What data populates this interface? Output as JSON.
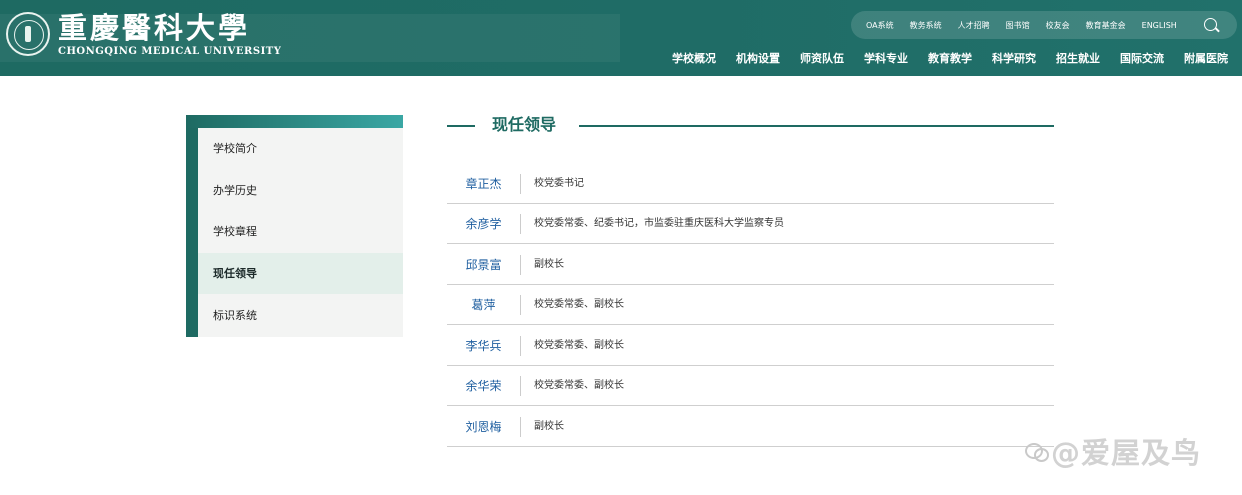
{
  "header": {
    "logo_cn": "重慶醫科大學",
    "logo_en": "CHONGQING MEDICAL UNIVERSITY",
    "utility_links": [
      "OA系统",
      "教务系统",
      "人才招聘",
      "图书馆",
      "校友会",
      "教育基金会",
      "ENGLISH"
    ],
    "main_nav": [
      "学校概况",
      "机构设置",
      "师资队伍",
      "学科专业",
      "教育教学",
      "科学研究",
      "招生就业",
      "国际交流",
      "附属医院"
    ]
  },
  "sidebar": {
    "items": [
      {
        "label": "学校简介",
        "active": false
      },
      {
        "label": "办学历史",
        "active": false
      },
      {
        "label": "学校章程",
        "active": false
      },
      {
        "label": "现任领导",
        "active": true
      },
      {
        "label": "标识系统",
        "active": false
      }
    ]
  },
  "main": {
    "title": "现任领导",
    "leaders": [
      {
        "name": "章正杰",
        "title": "校党委书记"
      },
      {
        "name": "余彦学",
        "title": "校党委常委、纪委书记，市监委驻重庆医科大学监察专员"
      },
      {
        "name": "邱景富",
        "title": "副校长"
      },
      {
        "name": "葛萍",
        "title": "校党委常委、副校长"
      },
      {
        "name": "李华兵",
        "title": "校党委常委、副校长"
      },
      {
        "name": "余华荣",
        "title": "校党委常委、副校长"
      },
      {
        "name": "刘恩梅",
        "title": "副校长"
      }
    ]
  },
  "watermark": {
    "text": "@爱屋及鸟"
  },
  "colors": {
    "brand": "#1e6a62",
    "link_name": "#1f5fa0",
    "active_bg": "#e3efea"
  },
  "icons": [
    "university-seal-icon",
    "search-icon",
    "watermark-logo-icon"
  ]
}
